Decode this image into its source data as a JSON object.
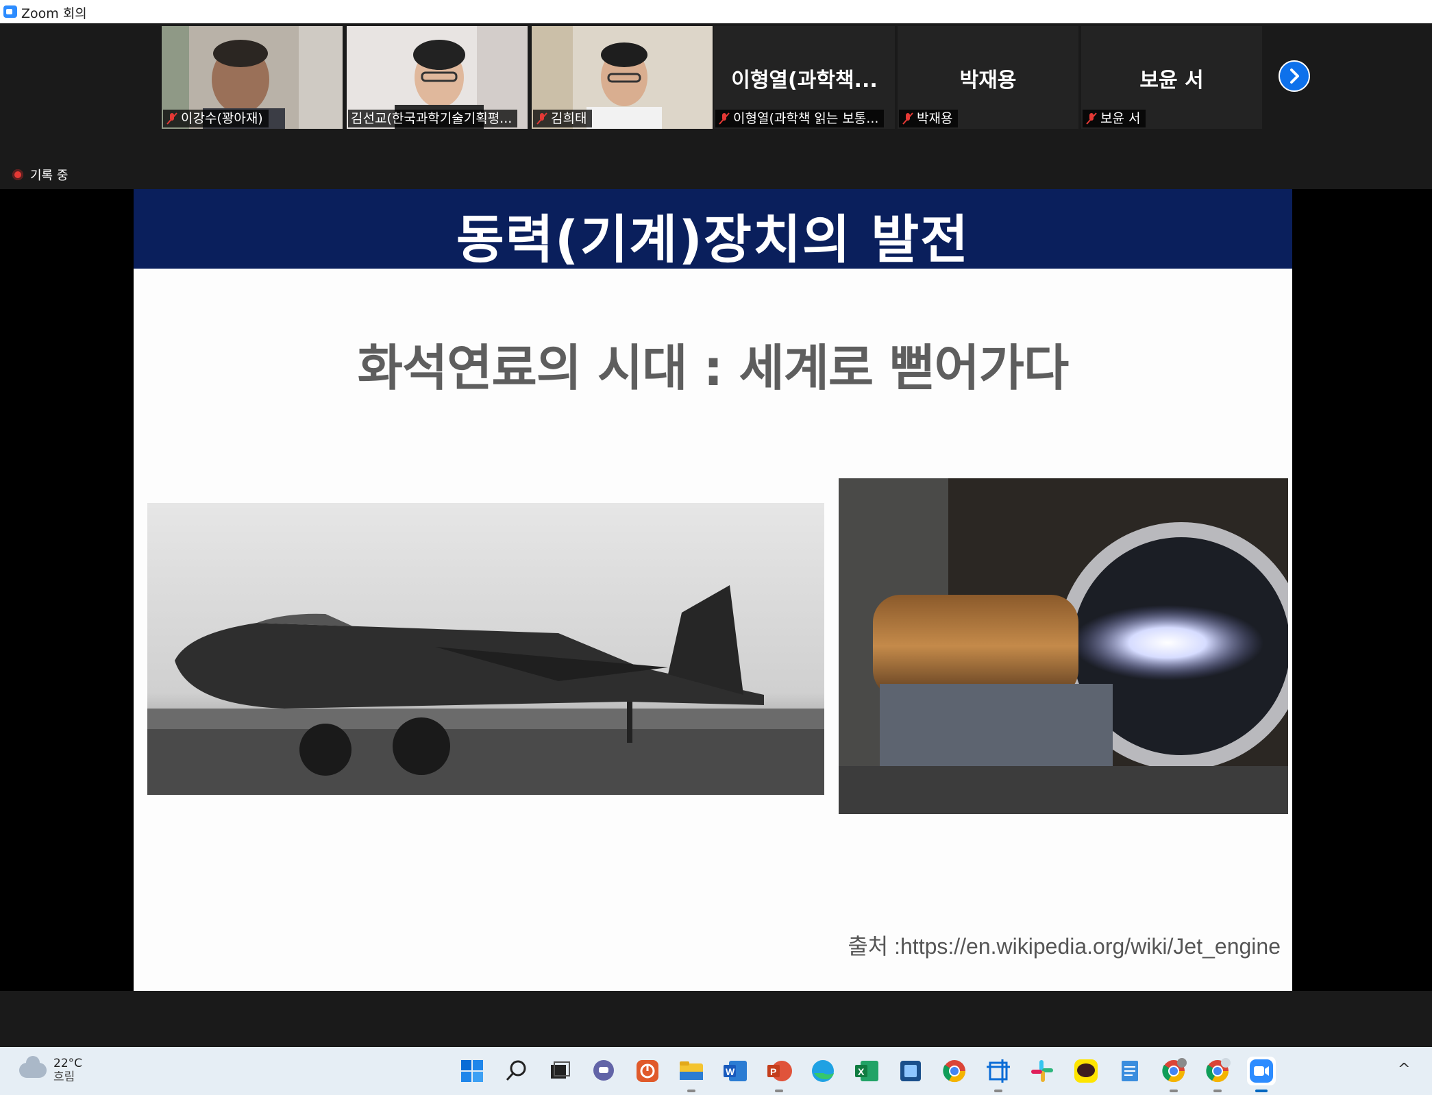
{
  "window": {
    "title": "Zoom 회의"
  },
  "participants": [
    {
      "label": "이강수(꽝아재)",
      "muted": true,
      "video": true
    },
    {
      "label": "김선교(한국과학기술기획평...",
      "muted": false,
      "video": true,
      "active": true
    },
    {
      "label": "김희태",
      "muted": true,
      "video": true
    },
    {
      "display_name": "이형열(과학책...",
      "label": "이형열(과학책 읽는 보통...",
      "muted": true,
      "video": false
    },
    {
      "display_name": "박재용",
      "label": "박재용",
      "muted": true,
      "video": false
    },
    {
      "display_name": "보윤 서",
      "label": "보윤 서",
      "muted": true,
      "video": false
    }
  ],
  "recording": {
    "label": "기록 중"
  },
  "slide": {
    "header": "동력(기계)장치의 발전",
    "subtitle": "화석연료의 시대 : 세계로 뻗어가다",
    "source": "출처 :https://en.wikipedia.org/wiki/Jet_engine"
  },
  "taskbar": {
    "weather": {
      "temperature": "22°C",
      "condition": "흐림"
    },
    "apps": [
      "start-icon",
      "search-icon",
      "task-view-icon",
      "teams-chat-icon",
      "power-app-icon",
      "file-explorer-icon",
      "word-icon",
      "powerpoint-icon",
      "edge-icon",
      "excel-icon",
      "hangul-icon",
      "chrome-icon",
      "snip-tool-icon",
      "slack-icon",
      "kakaotalk-icon",
      "notepad-icon",
      "chrome-profile-icon",
      "chrome-profile-2-icon",
      "zoom-icon"
    ],
    "tray": {
      "chevron": "^"
    }
  },
  "colors": {
    "slide_header_bg": "#0a1f5c",
    "active_speaker": "#9acd32",
    "accent": "#0e71eb",
    "recording": "#e53935"
  }
}
